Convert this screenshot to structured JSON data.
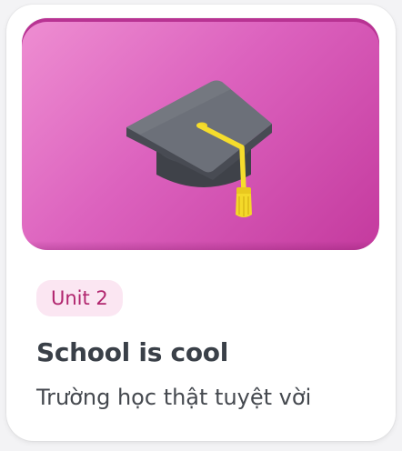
{
  "card": {
    "unit_label": "Unit 2",
    "title": "School is cool",
    "subtitle": "Trường học thật tuyệt vời",
    "icon": "graduation-cap-icon"
  },
  "colors": {
    "banner_start": "#ee8ed2",
    "banner_end": "#c43a9e",
    "badge_bg": "#fbe6f2",
    "badge_text": "#b1256e",
    "title_text": "#3a4048",
    "tassel": "#f5dc2a",
    "cap": "#5d6169"
  }
}
